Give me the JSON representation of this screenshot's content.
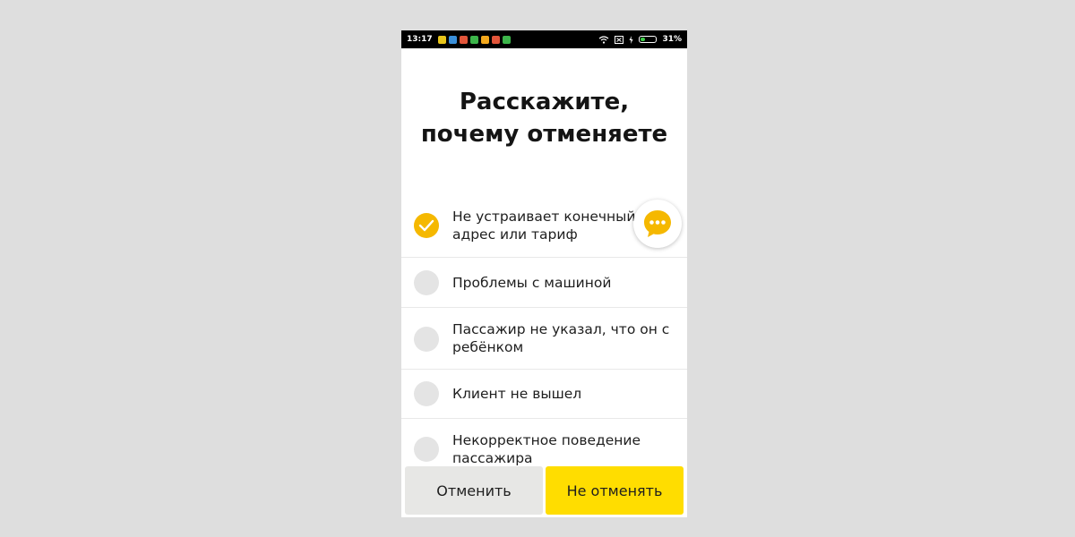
{
  "statusbar": {
    "time": "13:17",
    "battery_percent": "31%",
    "battery_level": 0.31,
    "notification_colors": [
      "#e8c51a",
      "#3a8fd9",
      "#e2553a",
      "#3cb54a",
      "#f4a81c",
      "#e2553a",
      "#3cb54a"
    ]
  },
  "page": {
    "title_line1": "Расскажите,",
    "title_line2": "почему отменяете"
  },
  "reasons": [
    {
      "label": "Не устраивает конечный адрес или тариф",
      "checked": true
    },
    {
      "label": "Проблемы с машиной",
      "checked": false
    },
    {
      "label": "Пассажир не указал, что он с ребёнком",
      "checked": false
    },
    {
      "label": "Клиент не вышел",
      "checked": false
    },
    {
      "label": "Некорректное поведение пассажира",
      "checked": false
    }
  ],
  "chat_button": {
    "icon": "chat-bubble-icon",
    "color": "#f5b800"
  },
  "actions": {
    "cancel_label": "Отменить",
    "keep_label": "Не отменять"
  },
  "colors": {
    "accent": "#ffdd00",
    "check": "#f5b800",
    "cancel_bg": "#e7e7e5"
  }
}
